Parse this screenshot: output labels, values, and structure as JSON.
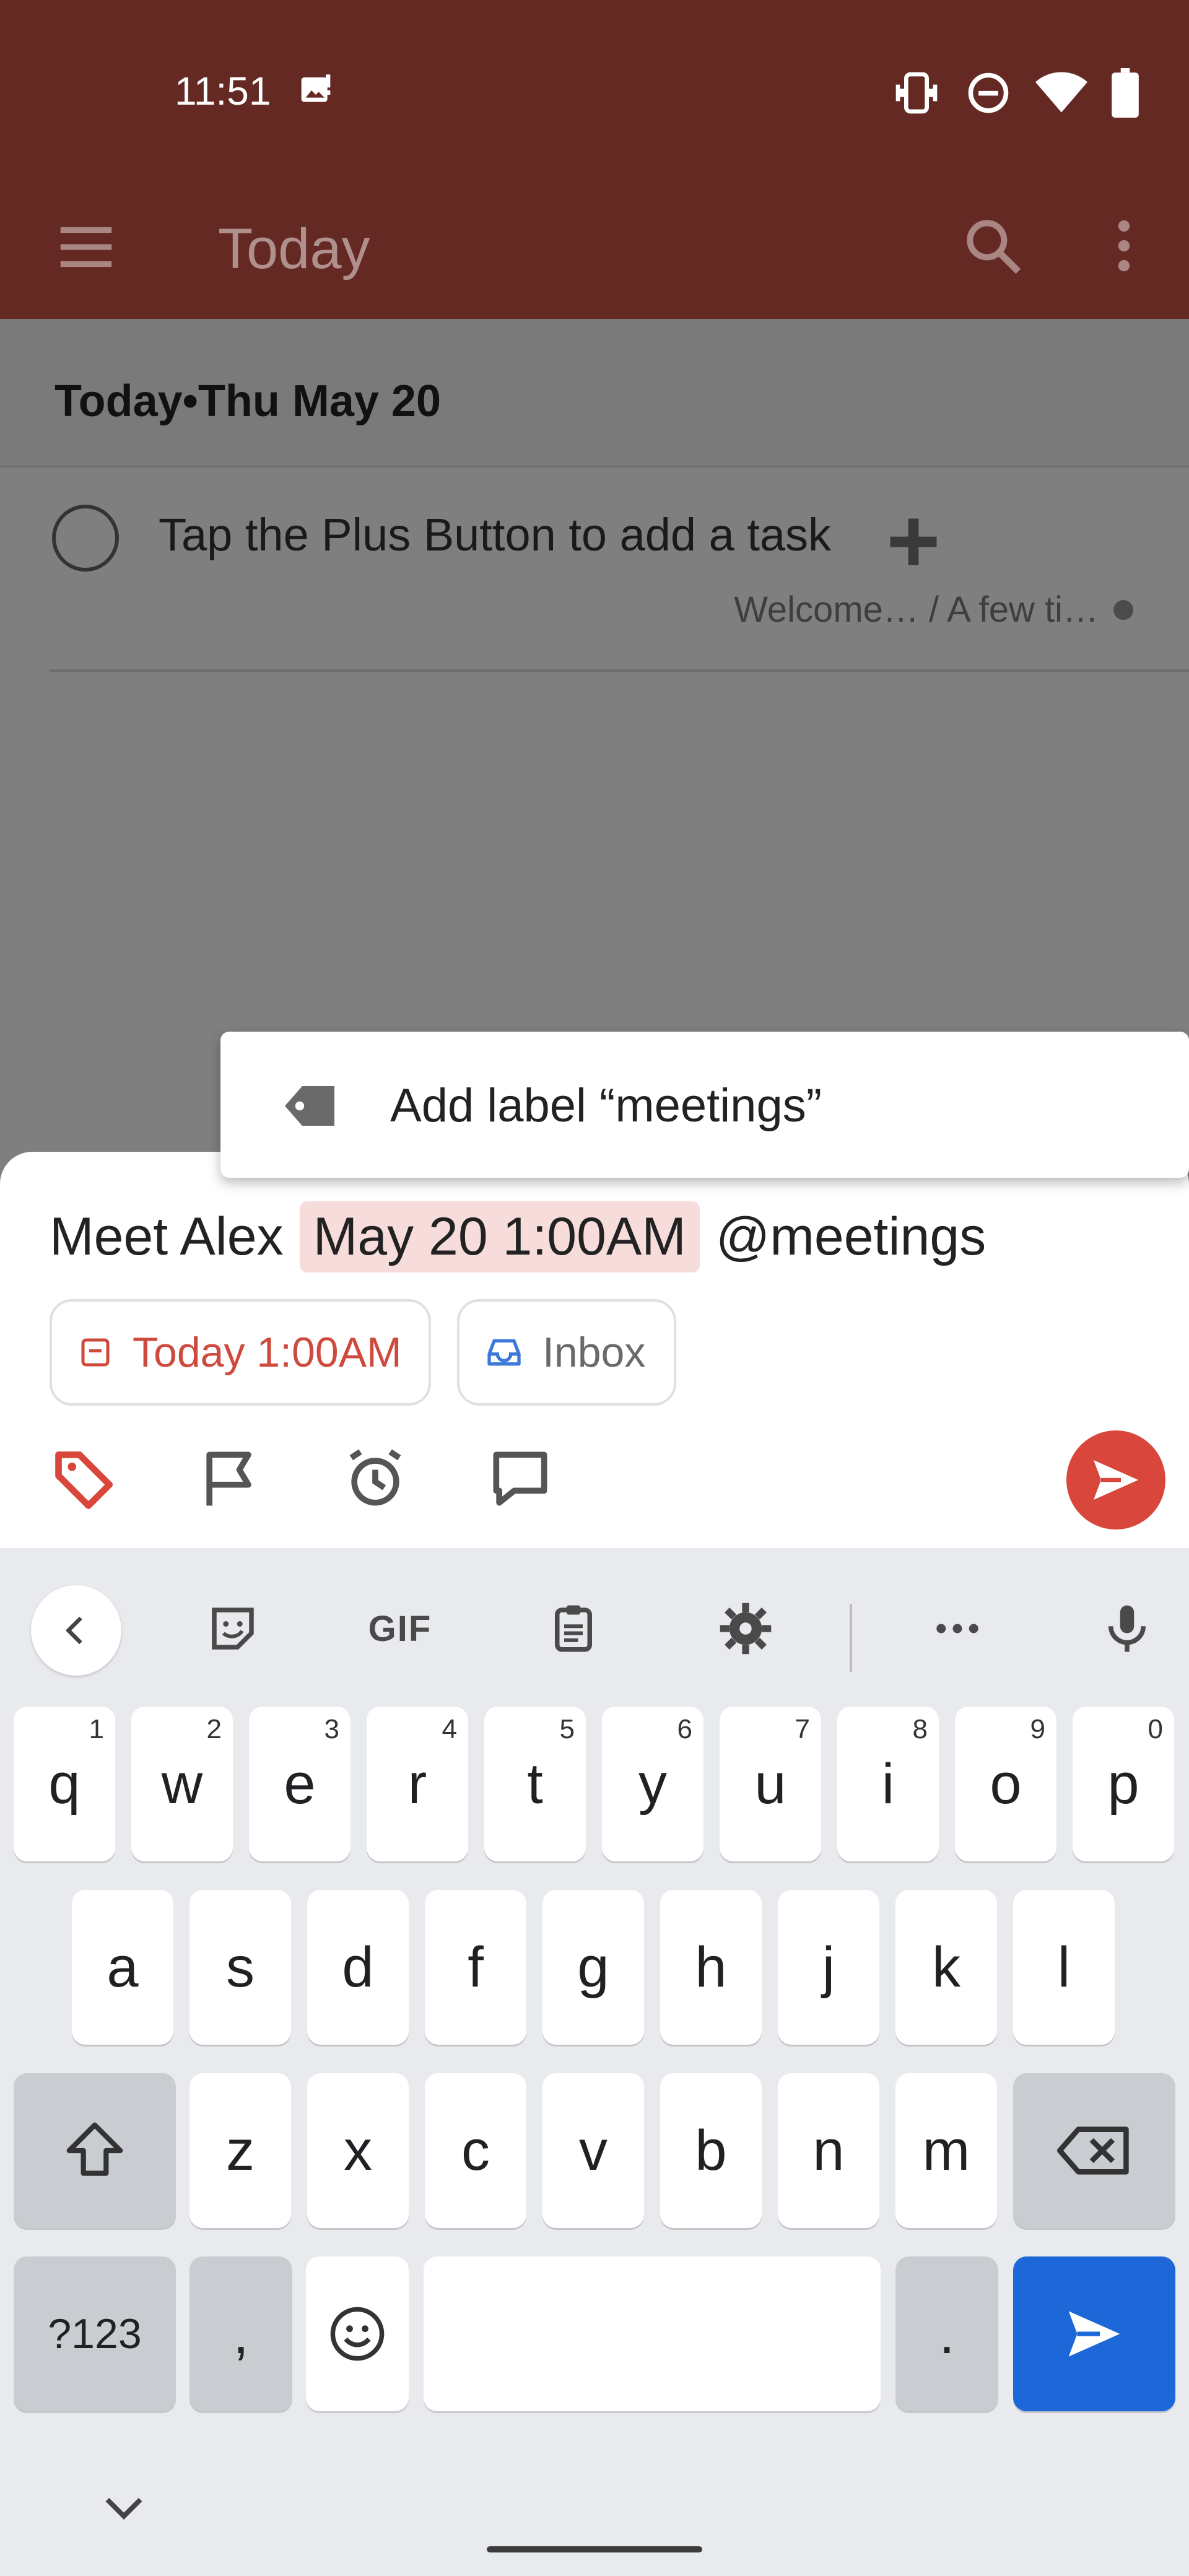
{
  "status_bar": {
    "time": "11:51"
  },
  "app_bar": {
    "title": "Today"
  },
  "section": {
    "header": "Today•Thu May 20"
  },
  "task": {
    "title": "Tap the Plus Button to add a task",
    "meta": "Welcome… / A few ti…"
  },
  "suggestion": {
    "text": "Add label “meetings”"
  },
  "quick_add": {
    "input_prefix": "Meet Alex",
    "input_date_highlight": "May 20 1:00AM",
    "input_suffix": "@meetings",
    "date_chip": "Today 1:00AM",
    "project_chip": "Inbox"
  },
  "keyboard": {
    "gif_label": "GIF",
    "row1": [
      {
        "k": "q",
        "n": "1"
      },
      {
        "k": "w",
        "n": "2"
      },
      {
        "k": "e",
        "n": "3"
      },
      {
        "k": "r",
        "n": "4"
      },
      {
        "k": "t",
        "n": "5"
      },
      {
        "k": "y",
        "n": "6"
      },
      {
        "k": "u",
        "n": "7"
      },
      {
        "k": "i",
        "n": "8"
      },
      {
        "k": "o",
        "n": "9"
      },
      {
        "k": "p",
        "n": "0"
      }
    ],
    "row2": [
      "a",
      "s",
      "d",
      "f",
      "g",
      "h",
      "j",
      "k",
      "l"
    ],
    "row3": [
      "z",
      "x",
      "c",
      "v",
      "b",
      "n",
      "m"
    ],
    "symbols_key": "?123",
    "comma_key": ",",
    "period_key": "."
  },
  "colors": {
    "accent": "#d9473c",
    "app_bar": "#652924",
    "keyboard_enter": "#1d67d9"
  }
}
